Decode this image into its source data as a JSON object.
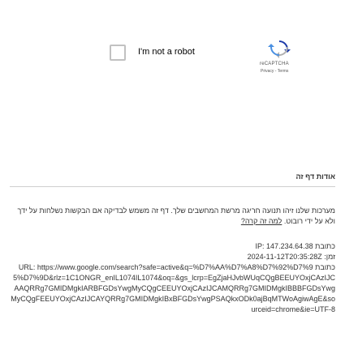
{
  "captcha": {
    "checkbox_label": "I'm not a robot",
    "brand": "reCAPTCHA",
    "privacy_link": "Privacy",
    "separator": " - ",
    "terms_link": "Terms",
    "logo_icon": "recaptcha-logo-icon"
  },
  "content": {
    "heading": "אודות דף זה",
    "paragraph_part1": "מערכות שלנו זיהו תנועה חריגה מרשת המחשבים שלך. דף זה משמש לבדיקה אם הבקשות נשלחות על ידך ולא על ידי רובוט. ",
    "paragraph_link": "למה זה קרה?",
    "ip_row": "כתובת IP: 147.234.64.38",
    "time_row": "זמן: 2024-11-12T20:35:28Z",
    "url_row": "כתובת URL: https://www.google.com/search?safe=active&q=%D7%AA%D7%A8%D7%92%D7%95%D7%9D&rlz=1C1ONGR_enIL1074IL1074&oq=&gs_lcrp=EgZjaHJvbWUqCQgBEEUYOxjCAzIJCAAQRRg7GMIDMgkIARBFGDsYwgMyCQgCEEUYOxjCAzIJCAMQRRg7GMIDMgkIBBBFGDsYwgMyCQgFEEUYOxjCAzIJCAYQRRg7GMIDMgkIBxBFGDsYwgPSAQkxODk0ajBqMTWoAgiwAgE&sourceid=chrome&ie=UTF-8"
  },
  "colors": {
    "logo_blue": "#1c3aa9",
    "logo_light": "#4a90e2",
    "logo_gray": "#b0b0b0"
  }
}
